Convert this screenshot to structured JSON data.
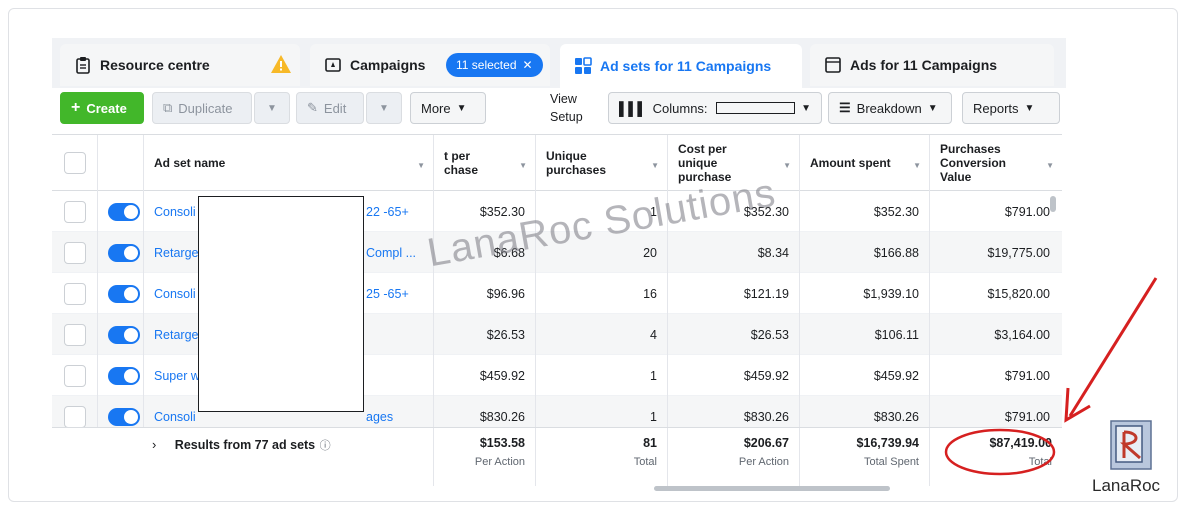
{
  "tabs": {
    "resource": "Resource centre",
    "campaigns": "Campaigns",
    "selected_pill": "11 selected",
    "adsets": "Ad sets for 11 Campaigns",
    "ads": "Ads for 11 Campaigns"
  },
  "toolbar": {
    "create": "Create",
    "duplicate": "Duplicate",
    "edit": "Edit",
    "more": "More",
    "view_setup_1": "View",
    "view_setup_2": "Setup",
    "columns": "Columns:",
    "breakdown": "Breakdown",
    "reports": "Reports"
  },
  "table": {
    "headers": {
      "name": "Ad set name",
      "cost_per_purchase": "t per\nchase",
      "unique_purchases": "Unique\npurchases",
      "cost_per_unique": "Cost per\nunique\npurchase",
      "amount_spent": "Amount spent",
      "conversion_value": "Purchases\nConversion\nValue"
    },
    "rows": [
      {
        "name": "Consoli",
        "tail": "22 -65+",
        "cpp": "$352.30",
        "unique": "1",
        "cpu": "$352.30",
        "spent": "$352.30",
        "value": "$791.00"
      },
      {
        "name": "Retarge",
        "tail": "Compl ...",
        "cpp": "$6.68",
        "unique": "20",
        "cpu": "$8.34",
        "spent": "$166.88",
        "value": "$19,775.00"
      },
      {
        "name": "Consoli",
        "tail": "25 -65+",
        "cpp": "$96.96",
        "unique": "16",
        "cpu": "$121.19",
        "spent": "$1,939.10",
        "value": "$15,820.00"
      },
      {
        "name": "Retarge",
        "tail": "",
        "cpp": "$26.53",
        "unique": "4",
        "cpu": "$26.53",
        "spent": "$106.11",
        "value": "$3,164.00"
      },
      {
        "name": "Super w",
        "tail": "",
        "cpp": "$459.92",
        "unique": "1",
        "cpu": "$459.92",
        "spent": "$459.92",
        "value": "$791.00"
      },
      {
        "name": "Consoli",
        "tail": "ages",
        "cpp": "$830.26",
        "unique": "1",
        "cpu": "$830.26",
        "spent": "$830.26",
        "value": "$791.00"
      }
    ],
    "summary": {
      "label": "Results from 77 ad sets",
      "cpp": "$153.58",
      "cpp_l": "Per Action",
      "unique": "81",
      "unique_l": "Total",
      "cpu": "$206.67",
      "cpu_l": "Per Action",
      "spent": "$16,739.94",
      "spent_l": "Total Spent",
      "value": "$87,419.00",
      "value_l": "Total"
    }
  },
  "watermark": "LanaRoc Solutions",
  "logo_text": "LanaRoc",
  "colors": {
    "accent": "#1877f2",
    "create": "#42b72a",
    "annotation": "#d62020"
  }
}
